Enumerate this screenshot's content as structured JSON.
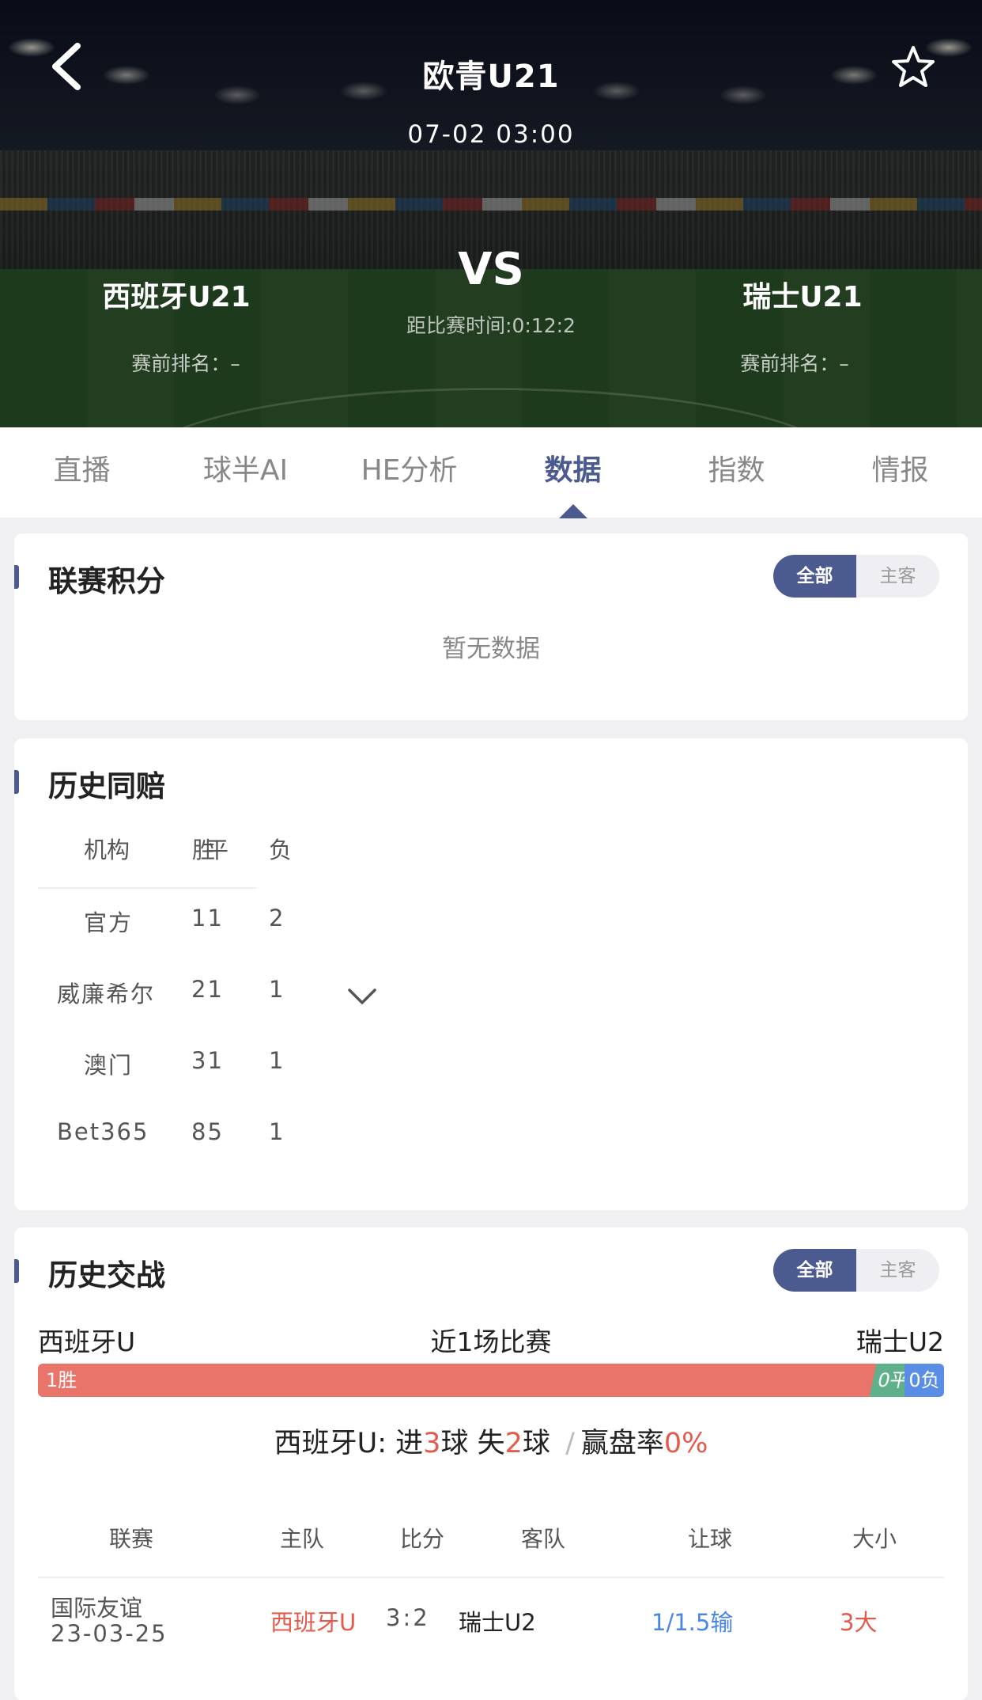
{
  "header": {
    "league": "欧青U21",
    "datetime": "07-02 03:00",
    "vs": "VS",
    "countdown": "距比赛时间:0:12:2",
    "home_team": "西班牙U21",
    "away_team": "瑞士U21",
    "home_rank": "赛前排名：–",
    "away_rank": "赛前排名：–"
  },
  "tabs": [
    {
      "label": "直播"
    },
    {
      "label": "球半AI"
    },
    {
      "label": "HE分析"
    },
    {
      "label": "数据",
      "active": true
    },
    {
      "label": "指数"
    },
    {
      "label": "情报"
    }
  ],
  "standings": {
    "title": "联赛积分",
    "seg_all": "全部",
    "seg_home": "主客",
    "empty": "暂无数据"
  },
  "odds_history": {
    "title": "历史同赔",
    "headers": {
      "org": "机构",
      "win": "胜",
      "draw": "平",
      "lose": "负"
    },
    "rows": [
      {
        "org": "官方",
        "wd": "11",
        "lose": "2"
      },
      {
        "org": "威廉希尔",
        "wd": "21",
        "lose": "1"
      },
      {
        "org": "澳门",
        "wd": "31",
        "lose": "1"
      },
      {
        "org": "Bet365",
        "wd": "85",
        "lose": "1"
      }
    ]
  },
  "h2h": {
    "title": "历史交战",
    "seg_all": "全部",
    "seg_home": "主客",
    "home": "西班牙U",
    "middle": "近1场比赛",
    "away": "瑞士U2",
    "win_label": "1胜",
    "draw_label": "0平",
    "lose_label": "0负",
    "summary": {
      "team": "西班牙U",
      "colon": ":",
      "scored_pre": "进",
      "scored": "3",
      "scored_post": "球",
      "conceded_pre": "失",
      "conceded": "2",
      "conceded_post": "球",
      "slash": "/",
      "rate_label": "赢盘率",
      "rate": "0%"
    },
    "columns": {
      "league": "联赛",
      "home": "主队",
      "score": "比分",
      "away": "客队",
      "handicap": "让球",
      "ou": "大小"
    },
    "matches": [
      {
        "league": "国际友谊",
        "date": "23-03-25",
        "home": "西班牙U",
        "score": "3:2",
        "away": "瑞士U2",
        "handicap": "1/1.5输",
        "ou": "3大"
      }
    ]
  },
  "colors": {
    "accent": "#4b5a8f",
    "red": "#e45a4b",
    "blue": "#4a86e6",
    "green": "#5fb18b"
  }
}
